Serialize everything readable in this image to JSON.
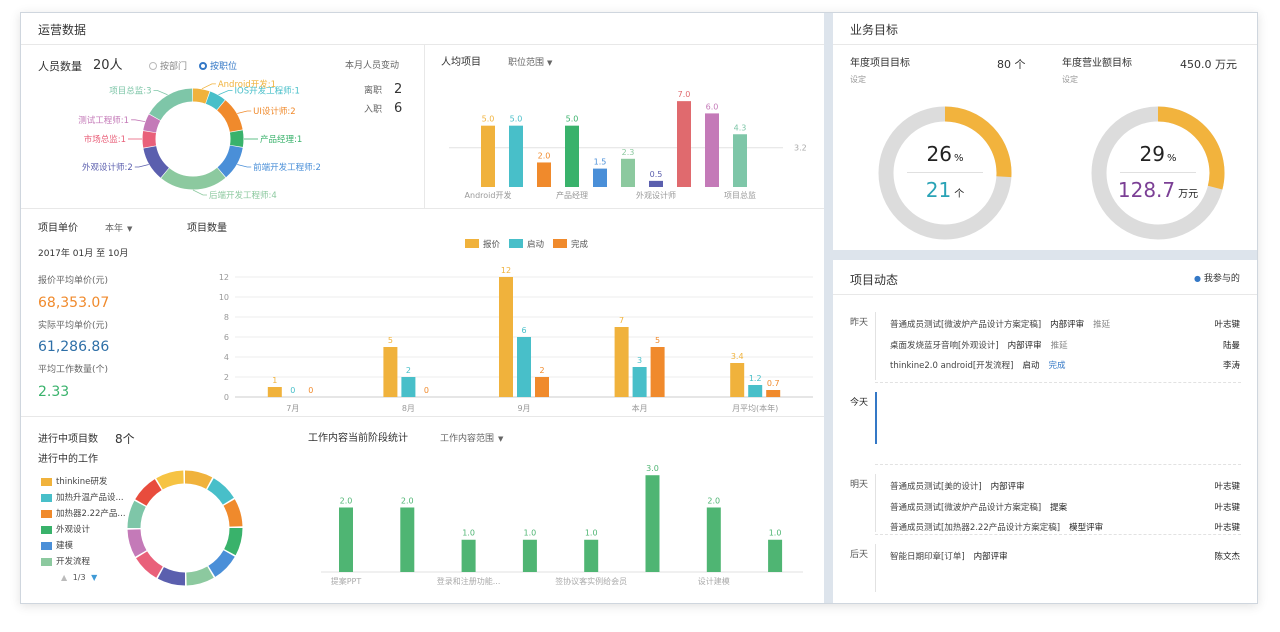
{
  "ops": {
    "title": "运营数据"
  },
  "staff": {
    "title": "人员数量",
    "count": "20人",
    "radio_dept": "按部门",
    "radio_pos": "按职位",
    "change_title": "本月人员变动",
    "leave_label": "离职",
    "leave_val": "2",
    "join_label": "入职",
    "join_val": "6",
    "slices": [
      {
        "label": "Android开发:1",
        "value": 1,
        "color": "#f0b23c"
      },
      {
        "label": "IOS开发工程师:1",
        "value": 1,
        "color": "#48bfc9"
      },
      {
        "label": "UI设计师:2",
        "value": 2,
        "color": "#f08a2c"
      },
      {
        "label": "产品经理:1",
        "value": 1,
        "color": "#39b26b"
      },
      {
        "label": "前端开发工程师:2",
        "value": 2,
        "color": "#4a8fd8"
      },
      {
        "label": "后端开发工程师:4",
        "value": 4,
        "color": "#8cc99f"
      },
      {
        "label": "外观设计师:2",
        "value": 2,
        "color": "#5b5fae"
      },
      {
        "label": "市场总监:1",
        "value": 1,
        "color": "#e9607a"
      },
      {
        "label": "测试工程师:1",
        "value": 1,
        "color": "#c47ab8"
      },
      {
        "label": "项目总监:3",
        "value": 3,
        "color": "#7ec6a8"
      }
    ]
  },
  "avg": {
    "title": "人均项目",
    "dropdown": "职位范围",
    "chart_data": {
      "type": "bar",
      "categories": [
        "Android开发",
        "IOS开发工程师",
        "UI设计师",
        "产品经理",
        "前端开发工程师",
        "后端开发工程师",
        "外观设计师",
        "市场总监",
        "测试工程师",
        "项目总监"
      ],
      "x_tick_labels": [
        "Android开发",
        "",
        "",
        "产品经理",
        "",
        "",
        "外观设计师",
        "",
        "",
        "项目总监"
      ],
      "values": [
        5.0,
        5.0,
        2.0,
        5.0,
        1.5,
        2.3,
        0.5,
        7.0,
        6.0,
        4.3
      ],
      "value_labels": [
        "5.0",
        "5.0",
        "2.0",
        "5.0",
        "1.5",
        "2.3",
        "0.5",
        "7.0",
        "6.0",
        "4.3"
      ],
      "colors": [
        "#f0b23c",
        "#48bfc9",
        "#f08a2c",
        "#39b26b",
        "#4a8fd8",
        "#8cc99f",
        "#5b5fae",
        "#e06a6e",
        "#c47ab8",
        "#7ec6a8"
      ],
      "ylim": [
        0,
        7.5
      ],
      "avg_value": 3.2,
      "avg_label": "3.2"
    }
  },
  "price": {
    "title": "项目单价",
    "dropdown": "本年",
    "range": "2017年 01月 至 10月",
    "quote_label": "报价平均单价(元)",
    "quote_val": "68,353.07",
    "actual_label": "实际平均单价(元)",
    "actual_val": "61,286.86",
    "work_label": "平均工作数量(个)",
    "work_val": "2.33",
    "quote_color": "#f08a2c",
    "actual_color": "#2e6fa7",
    "work_color": "#39b26b"
  },
  "count": {
    "title": "项目数量",
    "chart_data": {
      "type": "bar",
      "categories": [
        "7月",
        "8月",
        "9月",
        "本月",
        "月平均(本年)"
      ],
      "series": [
        {
          "name": "报价",
          "values": [
            1,
            5,
            12,
            7,
            3.4
          ],
          "labels": [
            "1",
            "5",
            "12",
            "7",
            "3.4"
          ],
          "color": "#f0b23c"
        },
        {
          "name": "启动",
          "values": [
            0,
            2,
            6,
            3,
            1.2
          ],
          "labels": [
            "0",
            "2",
            "6",
            "3",
            "1.2"
          ],
          "color": "#48bfc9"
        },
        {
          "name": "完成",
          "values": [
            0,
            0,
            2,
            5,
            0.7
          ],
          "labels": [
            "0",
            "0",
            "2",
            "5",
            "0.7"
          ],
          "color": "#f08a2c"
        }
      ],
      "yticks": [
        "0",
        "2",
        "4",
        "6",
        "8",
        "10",
        "12"
      ],
      "ylim": [
        0,
        12
      ],
      "grid": true,
      "legend": "top"
    }
  },
  "ongoing": {
    "title": "进行中项目数",
    "count": "8个",
    "work_title": "进行中的工作",
    "legend": [
      {
        "label": "thinkine研发",
        "color": "#f0b23c"
      },
      {
        "label": "加热升温产品设...",
        "color": "#48bfc9"
      },
      {
        "label": "加热器2.22产品...",
        "color": "#f08a2c"
      },
      {
        "label": "外观设计",
        "color": "#39b26b"
      },
      {
        "label": "建模",
        "color": "#4a8fd8"
      },
      {
        "label": "开发流程",
        "color": "#8cc99f"
      }
    ],
    "pager": "1/3",
    "ring": {
      "values": [
        1,
        1,
        1,
        1,
        1,
        1,
        1,
        1,
        1,
        1,
        1,
        1
      ],
      "colors": [
        "#f0b23c",
        "#48bfc9",
        "#f08a2c",
        "#39b26b",
        "#4a8fd8",
        "#8cc99f",
        "#5b5fae",
        "#e9607a",
        "#c47ab8",
        "#7ec6a8",
        "#e84c3d",
        "#f6c343"
      ]
    }
  },
  "stage": {
    "title": "工作内容当前阶段统计",
    "dropdown": "工作内容范围",
    "chart_data": {
      "type": "bar",
      "categories": [
        "提案PPT",
        "",
        "登录和注册功能...",
        "",
        "签协议客实例给会员",
        "",
        "设计建模",
        ""
      ],
      "values": [
        2.0,
        2.0,
        1.0,
        1.0,
        1.0,
        3.0,
        2.0,
        1.0
      ],
      "value_labels": [
        "2.0",
        "2.0",
        "1.0",
        "1.0",
        "1.0",
        "3.0",
        "2.0",
        "1.0"
      ],
      "ylim": [
        0,
        3.1
      ],
      "color": "#4fb573"
    }
  },
  "goals": {
    "title": "业务目标",
    "proj_title": "年度项目目标",
    "proj_sub": "设定",
    "proj_val": "80 个",
    "proj_pct": "26",
    "proj_pct_unit": "%",
    "proj_num": "21",
    "proj_num_unit": "个",
    "proj_fraction": 0.26,
    "proj_num_color": "#2aa3b6",
    "rev_title": "年度营业额目标",
    "rev_sub": "设定",
    "rev_val": "450.0 万元",
    "rev_pct": "29",
    "rev_pct_unit": "%",
    "rev_num": "128.7",
    "rev_num_unit": "万元",
    "rev_fraction": 0.29,
    "rev_num_color": "#7b3f95",
    "ring_color": "#f2b33d",
    "track_color": "#dcdcdc"
  },
  "dynamics": {
    "title": "项目动态",
    "filter": "我参与的",
    "groups": [
      {
        "day": "昨天",
        "items": [
          {
            "name": "普通成员测试[微波炉产品设计方案定稿]",
            "stage": "内部评审",
            "status": "推延",
            "person": "叶志键"
          },
          {
            "name": "桌面发烧蓝牙音响[外观设计]",
            "stage": "内部评审",
            "status": "推延",
            "person": "陆曼"
          },
          {
            "name": "thinkine2.0 android[开发流程]",
            "stage": "启动",
            "status": "完成",
            "person": "李涛"
          }
        ]
      },
      {
        "day": "今天",
        "items": []
      },
      {
        "day": "明天",
        "items": [
          {
            "name": "普通成员测试[美的设计]",
            "stage": "内部评审",
            "status": "",
            "person": "叶志键"
          },
          {
            "name": "普通成员测试[微波炉产品设计方案定稿]",
            "stage": "提案",
            "status": "",
            "person": "叶志键"
          },
          {
            "name": "普通成员测试[加热器2.22产品设计方案定稿]",
            "stage": "模型评审",
            "status": "",
            "person": "叶志键"
          }
        ]
      },
      {
        "day": "后天",
        "items": [
          {
            "name": "智能日期印章[订单]",
            "stage": "内部评审",
            "status": "",
            "person": "陈文杰"
          }
        ]
      }
    ]
  }
}
